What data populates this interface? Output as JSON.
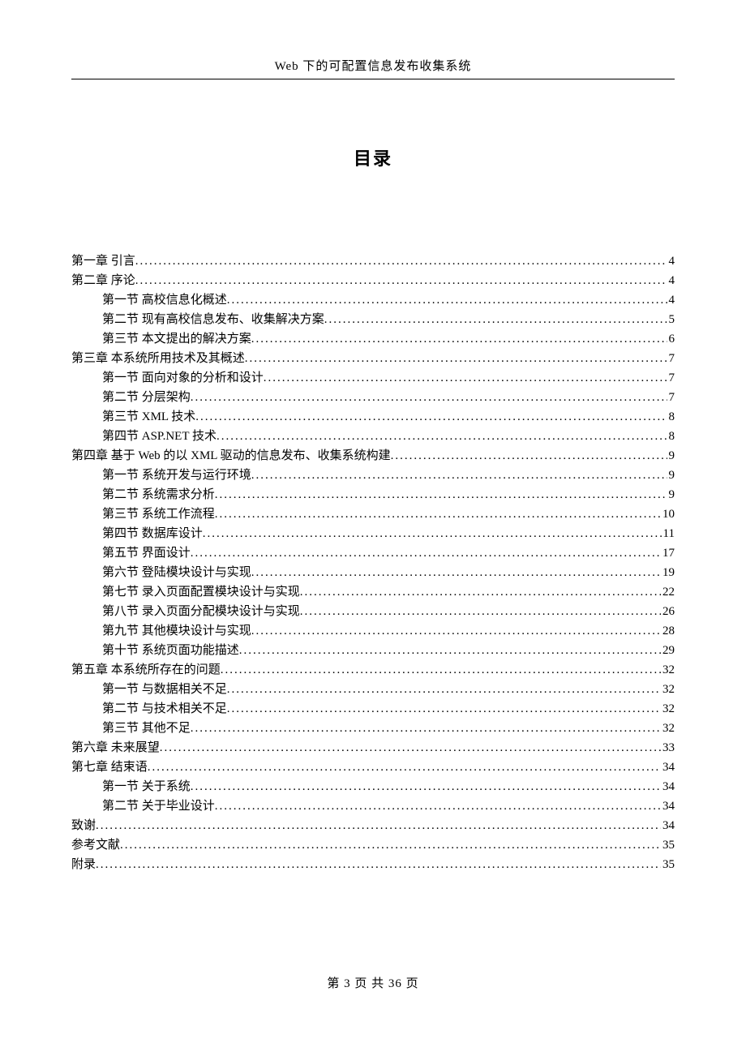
{
  "header": "Web 下的可配置信息发布收集系统",
  "toc_title": "目录",
  "footer": "第 3 页 共 36 页",
  "entries": [
    {
      "level": 1,
      "label": "第一章 引言",
      "page": "4"
    },
    {
      "level": 1,
      "label": "第二章 序论",
      "page": "4"
    },
    {
      "level": 2,
      "label": "第一节 高校信息化概述",
      "page": "4"
    },
    {
      "level": 2,
      "label": "第二节 现有高校信息发布、收集解决方案",
      "page": "5"
    },
    {
      "level": 2,
      "label": "第三节 本文提出的解决方案",
      "page": "6"
    },
    {
      "level": 1,
      "label": "第三章 本系统所用技术及其概述",
      "page": "7"
    },
    {
      "level": 2,
      "label": "第一节 面向对象的分析和设计",
      "page": "7"
    },
    {
      "level": 2,
      "label": "第二节 分层架构",
      "page": "7"
    },
    {
      "level": 2,
      "label": "第三节 XML 技术",
      "page": "8"
    },
    {
      "level": 2,
      "label": "第四节 ASP.NET 技术",
      "page": "8"
    },
    {
      "level": 1,
      "label": "第四章 基于 Web 的以 XML 驱动的信息发布、收集系统构建",
      "page": "9"
    },
    {
      "level": 2,
      "label": "第一节 系统开发与运行环境",
      "page": "9"
    },
    {
      "level": 2,
      "label": "第二节 系统需求分析",
      "page": "9"
    },
    {
      "level": 2,
      "label": "第三节 系统工作流程",
      "page": "10"
    },
    {
      "level": 2,
      "label": "第四节 数据库设计",
      "page": "11"
    },
    {
      "level": 2,
      "label": "第五节 界面设计",
      "page": "17"
    },
    {
      "level": 2,
      "label": "第六节 登陆模块设计与实现",
      "page": "19"
    },
    {
      "level": 2,
      "label": "第七节 录入页面配置模块设计与实现",
      "page": "22"
    },
    {
      "level": 2,
      "label": "第八节 录入页面分配模块设计与实现",
      "page": "26"
    },
    {
      "level": 2,
      "label": "第九节 其他模块设计与实现",
      "page": "28"
    },
    {
      "level": 2,
      "label": "第十节 系统页面功能描述",
      "page": "29"
    },
    {
      "level": 1,
      "label": "第五章 本系统所存在的问题",
      "page": "32"
    },
    {
      "level": 2,
      "label": "第一节 与数据相关不足",
      "page": "32"
    },
    {
      "level": 2,
      "label": "第二节 与技术相关不足",
      "page": "32"
    },
    {
      "level": 2,
      "label": "第三节 其他不足",
      "page": "32"
    },
    {
      "level": 1,
      "label": "第六章 未来展望",
      "page": "33"
    },
    {
      "level": 1,
      "label": "第七章 结束语",
      "page": "34"
    },
    {
      "level": 2,
      "label": "第一节 关于系统",
      "page": "34"
    },
    {
      "level": 2,
      "label": "第二节 关于毕业设计",
      "page": "34"
    },
    {
      "level": 1,
      "label": "致谢",
      "page": "34"
    },
    {
      "level": 1,
      "label": "参考文献",
      "page": "35"
    },
    {
      "level": 1,
      "label": "附录",
      "page": "35"
    }
  ]
}
